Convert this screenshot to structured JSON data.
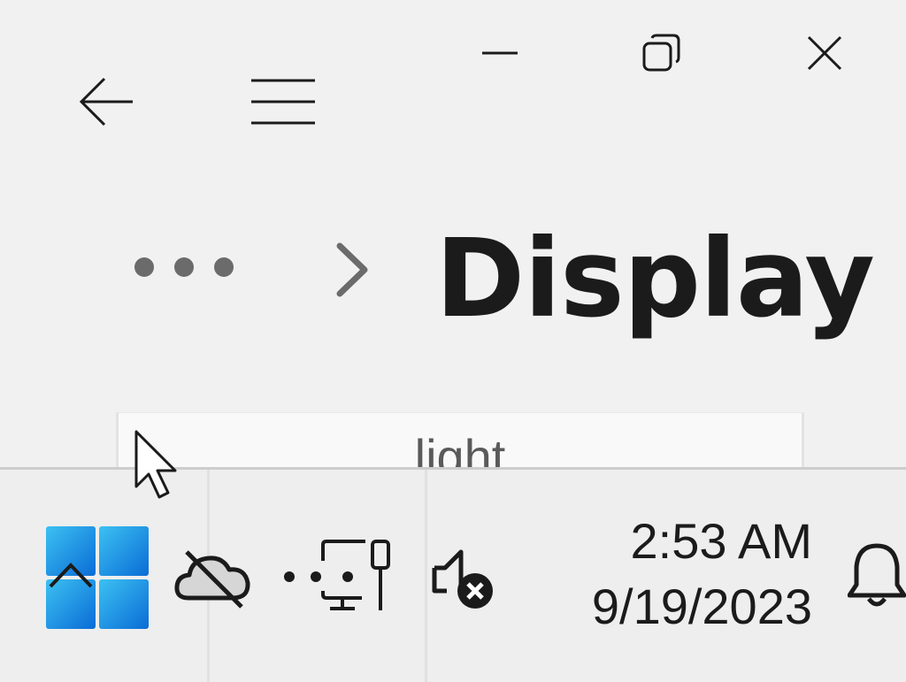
{
  "window": {
    "caption": {
      "minimize_icon": "minimize-icon",
      "maximize_icon": "restore-icon",
      "close_icon": "close-icon"
    },
    "nav": {
      "back_icon": "back-arrow-icon",
      "menu_icon": "hamburger-menu-icon"
    },
    "breadcrumb": {
      "overflow_icon": "more-dots-icon",
      "separator_icon": "chevron-right-icon",
      "title": "Display"
    },
    "card": {
      "label": "light"
    }
  },
  "taskbar": {
    "start_icon": "windows-start-icon",
    "tray": {
      "onedrive_icon": "onedrive-offline-icon",
      "network_icon": "network-disconnected-icon",
      "volume_icon": "volume-muted-icon"
    },
    "clock": {
      "time": "2:53 AM",
      "date": "9/19/2023"
    },
    "notification_icon": "bell-icon"
  },
  "colors": {
    "background": "#f0f0f0",
    "text": "#1b1b1b",
    "start_blue_light": "#3cc1f2",
    "start_blue_dark": "#0a6cd6"
  }
}
